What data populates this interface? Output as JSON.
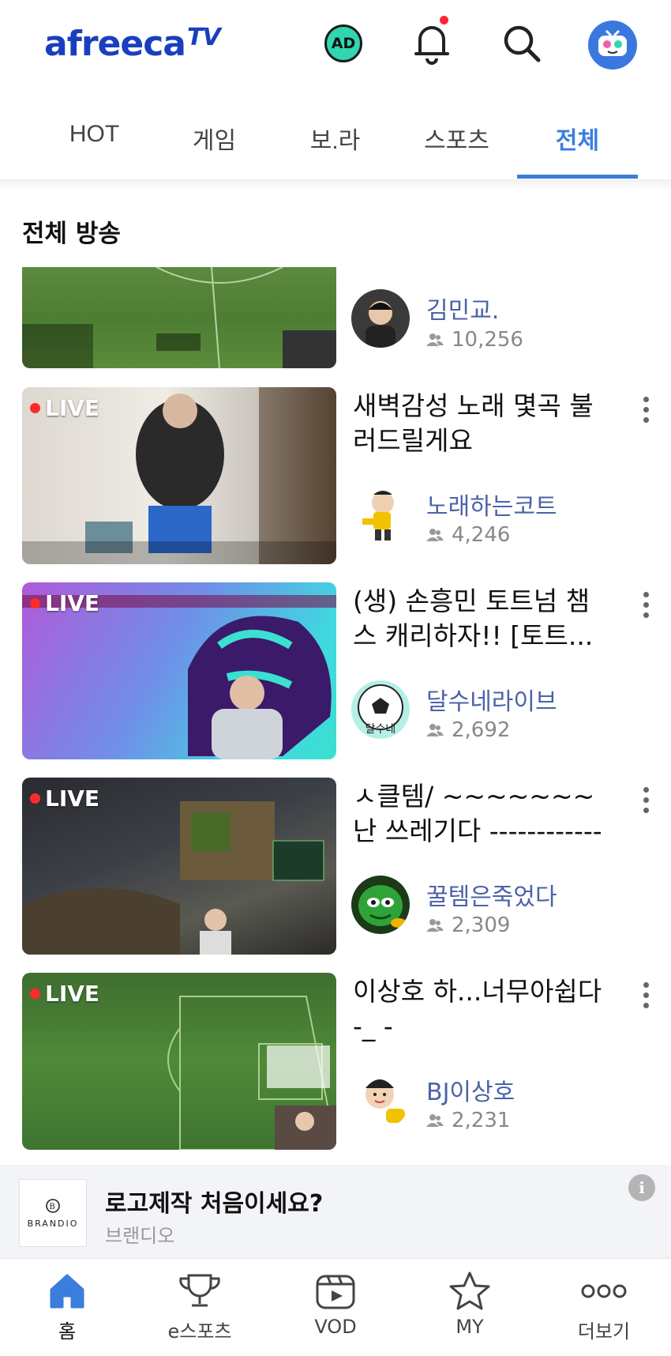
{
  "header": {
    "logo": "afreeca",
    "logo_tv": "TV",
    "ad_icon_label": "AD"
  },
  "tabs": [
    {
      "label": "HOT"
    },
    {
      "label": "게임"
    },
    {
      "label": "보.라"
    },
    {
      "label": "스포츠"
    },
    {
      "label": "전체"
    }
  ],
  "active_tab": "전체",
  "section_title": "전체 방송",
  "broadcasts": [
    {
      "title": "",
      "channel": "김민교.",
      "viewers": "10,256",
      "live": false
    },
    {
      "title": "새벽감성 노래 몇곡 불러드릴게요",
      "channel": "노래하는코트",
      "viewers": "4,246",
      "live": true
    },
    {
      "title": "(생) 손흥민 토트넘 챔스 캐리하자!! [토트...",
      "channel": "달수네라이브",
      "viewers": "2,692",
      "live": true
    },
    {
      "title": "ㅅ클템/ ~~~~~~~ 난 쓰레기다 ------------",
      "channel": "꿀템은죽었다",
      "viewers": "2,309",
      "live": true
    },
    {
      "title": "이상호 하...너무아쉽다 -_ -",
      "channel": "BJ이상호",
      "viewers": "2,231",
      "live": true
    }
  ],
  "live_label": "LIVE",
  "ad_banner": {
    "logo_text": "BRANDIO",
    "title": "로고제작 처음이세요?",
    "subtitle": "브랜디오",
    "info": "i"
  },
  "bottom_nav": [
    {
      "label": "홈",
      "icon": "home-icon"
    },
    {
      "label": "e스포츠",
      "icon": "trophy-icon"
    },
    {
      "label": "VOD",
      "icon": "vod-icon"
    },
    {
      "label": "MY",
      "icon": "star-icon"
    },
    {
      "label": "더보기",
      "icon": "more-icon"
    }
  ],
  "colors": {
    "accent": "#3b7ddd",
    "logo": "#1a3fbe",
    "channel": "#4a63a8",
    "live_dot": "#ff2a2a"
  }
}
